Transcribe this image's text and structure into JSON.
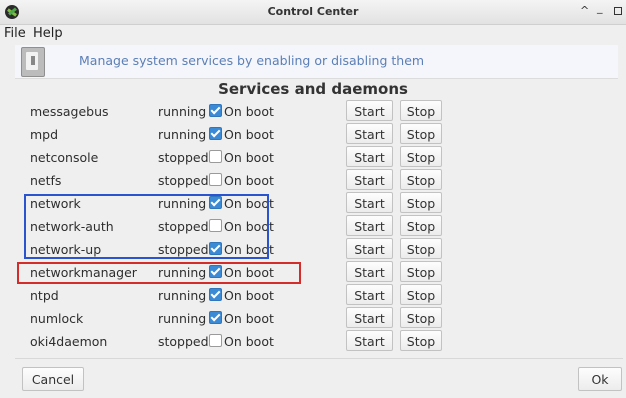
{
  "window": {
    "title": "Control Center",
    "controls": [
      "^",
      "_"
    ]
  },
  "menu": {
    "items": [
      "File",
      "Help"
    ]
  },
  "banner": {
    "text": "Manage system services by enabling or disabling them"
  },
  "section_title": "Services and daemons",
  "services": [
    {
      "name": "messagebus",
      "status": "running",
      "on_boot": true,
      "on_boot_label": "On boot",
      "start_label": "Start",
      "stop_label": "Stop"
    },
    {
      "name": "mpd",
      "status": "running",
      "on_boot": true,
      "on_boot_label": "On boot",
      "start_label": "Start",
      "stop_label": "Stop"
    },
    {
      "name": "netconsole",
      "status": "stopped",
      "on_boot": false,
      "on_boot_label": "On boot",
      "start_label": "Start",
      "stop_label": "Stop"
    },
    {
      "name": "netfs",
      "status": "stopped",
      "on_boot": false,
      "on_boot_label": "On boot",
      "start_label": "Start",
      "stop_label": "Stop"
    },
    {
      "name": "network",
      "status": "running",
      "on_boot": true,
      "on_boot_label": "On boot",
      "start_label": "Start",
      "stop_label": "Stop"
    },
    {
      "name": "network-auth",
      "status": "stopped",
      "on_boot": false,
      "on_boot_label": "On boot",
      "start_label": "Start",
      "stop_label": "Stop"
    },
    {
      "name": "network-up",
      "status": "stopped",
      "on_boot": true,
      "on_boot_label": "On boot",
      "start_label": "Start",
      "stop_label": "Stop"
    },
    {
      "name": "networkmanager",
      "status": "running",
      "on_boot": true,
      "on_boot_label": "On boot",
      "start_label": "Start",
      "stop_label": "Stop"
    },
    {
      "name": "ntpd",
      "status": "running",
      "on_boot": true,
      "on_boot_label": "On boot",
      "start_label": "Start",
      "stop_label": "Stop"
    },
    {
      "name": "numlock",
      "status": "running",
      "on_boot": true,
      "on_boot_label": "On boot",
      "start_label": "Start",
      "stop_label": "Stop"
    },
    {
      "name": "oki4daemon",
      "status": "stopped",
      "on_boot": false,
      "on_boot_label": "On boot",
      "start_label": "Start",
      "stop_label": "Stop"
    }
  ],
  "footer": {
    "cancel_label": "Cancel",
    "ok_label": "Ok"
  },
  "colors": {
    "checkbox_checked": "#3a8ad6",
    "highlight_blue": "#2a53d0",
    "highlight_red": "#d42b2b",
    "banner_text": "#5b7fb6"
  }
}
